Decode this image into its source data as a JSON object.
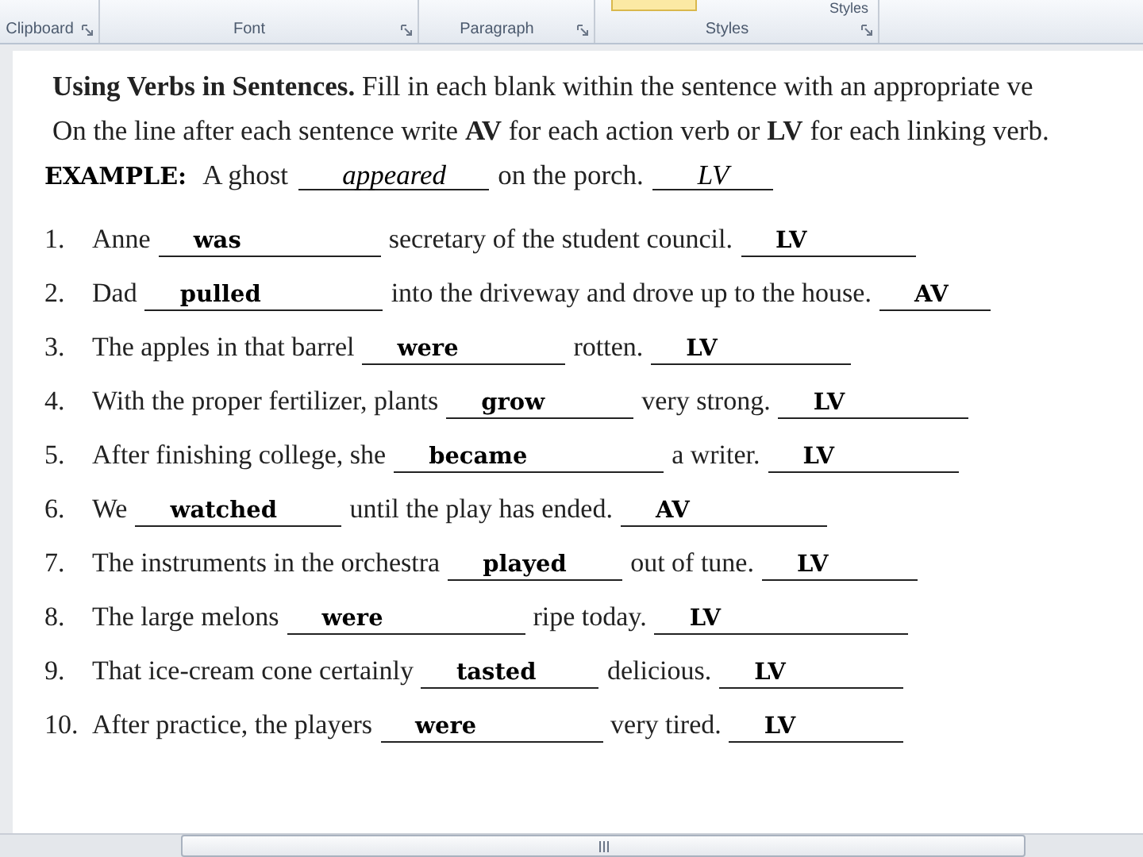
{
  "ribbon": {
    "groups": [
      "Clipboard",
      "Font",
      "Paragraph",
      "Styles"
    ],
    "styles_button": "Styles"
  },
  "worksheet": {
    "heading": "**Using Verbs in Sentences.** Fill in each blank within the sentence with an appropriate ve",
    "instruction": "On the line after each sentence write **AV** for each action verb or **LV** for each linking verb.",
    "example": {
      "label": "EXAMPLE:",
      "before": "A ghost",
      "answer": "appeared",
      "after": "on the porch.",
      "verb_type": "LV"
    },
    "items": [
      {
        "number": "1.",
        "before": "Anne",
        "answer": "was",
        "after": "secretary of the student council.",
        "verb_type": "LV"
      },
      {
        "number": "2.",
        "before": "Dad",
        "answer": "pulled",
        "after": "into the driveway and drove up to the house.",
        "verb_type": "AV"
      },
      {
        "number": "3.",
        "before": "The apples in that barrel",
        "answer": "were",
        "after": "rotten.",
        "verb_type": "LV"
      },
      {
        "number": "4.",
        "before": "With the proper fertilizer, plants",
        "answer": "grow",
        "after": "very strong.",
        "verb_type": "LV"
      },
      {
        "number": "5.",
        "before": "After finishing college, she",
        "answer": "became",
        "after": "a writer.",
        "verb_type": "LV"
      },
      {
        "number": "6.",
        "before": "We",
        "answer": "watched",
        "after": "until the play has ended.",
        "verb_type": "AV"
      },
      {
        "number": "7.",
        "before": "The instruments in the orchestra",
        "answer": "played",
        "after": "out of tune.",
        "verb_type": "LV"
      },
      {
        "number": "8.",
        "before": "The large melons",
        "answer": "were",
        "after": "ripe today.",
        "verb_type": "LV"
      },
      {
        "number": "9.",
        "before": "That ice-cream cone certainly",
        "answer": "tasted",
        "after": "delicious.",
        "verb_type": "LV"
      },
      {
        "number": "10.",
        "before": "After practice, the players",
        "answer": "were",
        "after": "very tired.",
        "verb_type": "LV"
      }
    ]
  }
}
